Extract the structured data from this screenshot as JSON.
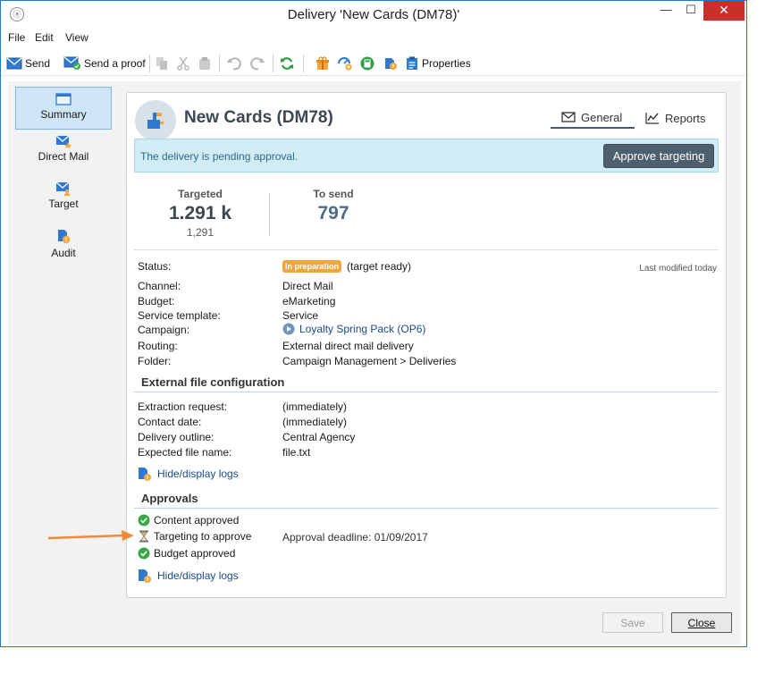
{
  "window": {
    "title": "Delivery 'New Cards (DM78)'",
    "app_icon": "ⓐ",
    "minimize": "—",
    "maximize": "☐",
    "close": "✕"
  },
  "menu": [
    "File",
    "Edit",
    "View"
  ],
  "toolbar": {
    "send": "Send",
    "send_proof": "Send a proof",
    "properties": "Properties"
  },
  "sidebar": [
    {
      "label": "Summary",
      "icon": "summary-icon",
      "active": true
    },
    {
      "label": "Direct Mail",
      "icon": "direct-mail-icon"
    },
    {
      "label": "Target",
      "icon": "target-icon"
    },
    {
      "label": "Audit",
      "icon": "audit-icon"
    }
  ],
  "header": {
    "title": "New Cards (DM78)",
    "tabs": [
      {
        "label": "General",
        "icon": "envelope-icon",
        "active": true
      },
      {
        "label": "Reports",
        "icon": "line-chart-icon"
      }
    ]
  },
  "banner": {
    "text": "The delivery is pending approval.",
    "button": "Approve targeting"
  },
  "stats": {
    "targeted_label": "Targeted",
    "targeted_value": "1.291 k",
    "targeted_sub": "1,291",
    "to_send_label": "To send",
    "to_send_value": "797"
  },
  "status": {
    "label": "Status:",
    "badge": "In preparation",
    "text": "(target ready)",
    "last_modified": "Last modified today"
  },
  "fields": [
    {
      "label": "Channel:",
      "value": "Direct Mail"
    },
    {
      "label": "Budget:",
      "value": "eMarketing"
    },
    {
      "label": "Service template:",
      "value": "Service"
    },
    {
      "label": "Campaign:",
      "value": "Loyalty Spring Pack (OP6)"
    },
    {
      "label": "Routing:",
      "value": "External direct mail delivery"
    },
    {
      "label": "Folder:",
      "value": "Campaign Management > Deliveries"
    }
  ],
  "external": {
    "title": "External file configuration",
    "fields": [
      {
        "label": "Extraction request:",
        "value": "(immediately)"
      },
      {
        "label": "Contact date:",
        "value": "(immediately)"
      },
      {
        "label": "Delivery outline:",
        "value": "Central Agency"
      },
      {
        "label": "Expected file name:",
        "value": "file.txt"
      }
    ],
    "log_link": "Hide/display logs"
  },
  "approvals": {
    "title": "Approvals",
    "items": [
      {
        "label": "Content approved",
        "state": "approved"
      },
      {
        "label": "Targeting to approve",
        "state": "pending"
      },
      {
        "label": "Budget approved",
        "state": "approved"
      }
    ],
    "deadline": "Approval deadline: 01/09/2017",
    "log_link": "Hide/display logs"
  },
  "footer": {
    "save": "Save",
    "close": "Close"
  },
  "colors": {
    "accent": "#1979ca",
    "banner_bg": "#d1ecf4",
    "badge": "#f0a63a",
    "approve_button": "#4e5f70",
    "approved": "#3aa74a",
    "arrow": "#f08a3a"
  }
}
